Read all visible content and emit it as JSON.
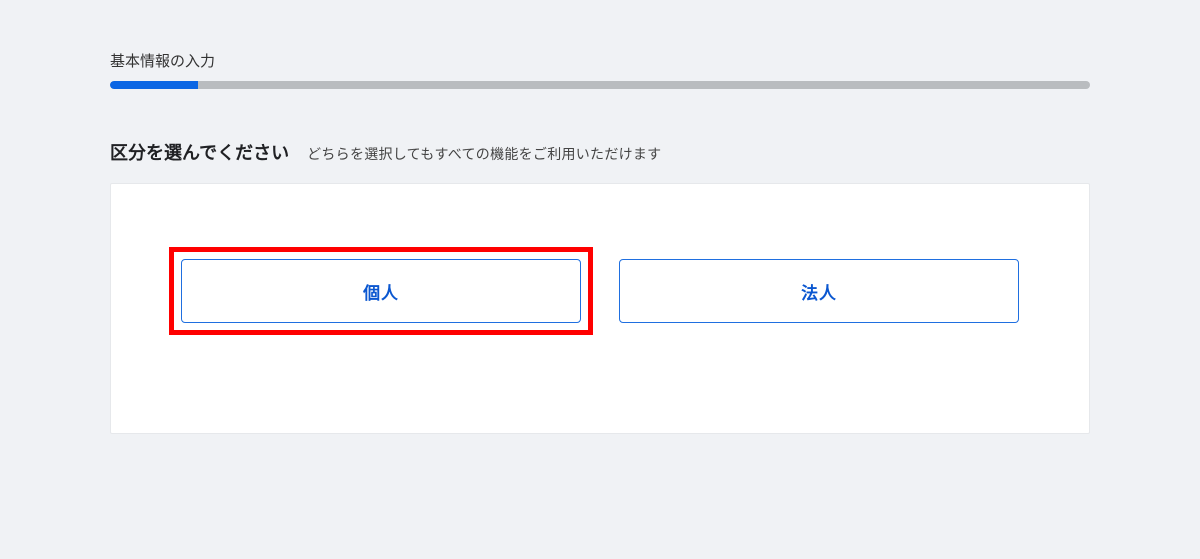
{
  "progress": {
    "step_label": "基本情報の入力",
    "percent": 9
  },
  "question": {
    "heading": "区分を選んでください",
    "subheading": "どちらを選択してもすべての機能をご利用いただけます"
  },
  "options": {
    "individual": "個人",
    "corporate": "法人"
  }
}
